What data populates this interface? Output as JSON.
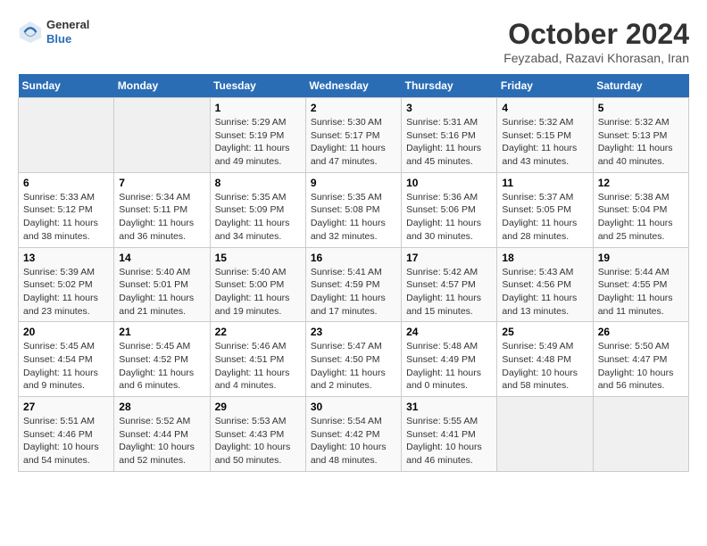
{
  "header": {
    "logo_general": "General",
    "logo_blue": "Blue",
    "month": "October 2024",
    "location": "Feyzabad, Razavi Khorasan, Iran"
  },
  "weekdays": [
    "Sunday",
    "Monday",
    "Tuesday",
    "Wednesday",
    "Thursday",
    "Friday",
    "Saturday"
  ],
  "weeks": [
    [
      {
        "day": "",
        "sunrise": "",
        "sunset": "",
        "daylight": ""
      },
      {
        "day": "",
        "sunrise": "",
        "sunset": "",
        "daylight": ""
      },
      {
        "day": "1",
        "sunrise": "Sunrise: 5:29 AM",
        "sunset": "Sunset: 5:19 PM",
        "daylight": "Daylight: 11 hours and 49 minutes."
      },
      {
        "day": "2",
        "sunrise": "Sunrise: 5:30 AM",
        "sunset": "Sunset: 5:17 PM",
        "daylight": "Daylight: 11 hours and 47 minutes."
      },
      {
        "day": "3",
        "sunrise": "Sunrise: 5:31 AM",
        "sunset": "Sunset: 5:16 PM",
        "daylight": "Daylight: 11 hours and 45 minutes."
      },
      {
        "day": "4",
        "sunrise": "Sunrise: 5:32 AM",
        "sunset": "Sunset: 5:15 PM",
        "daylight": "Daylight: 11 hours and 43 minutes."
      },
      {
        "day": "5",
        "sunrise": "Sunrise: 5:32 AM",
        "sunset": "Sunset: 5:13 PM",
        "daylight": "Daylight: 11 hours and 40 minutes."
      }
    ],
    [
      {
        "day": "6",
        "sunrise": "Sunrise: 5:33 AM",
        "sunset": "Sunset: 5:12 PM",
        "daylight": "Daylight: 11 hours and 38 minutes."
      },
      {
        "day": "7",
        "sunrise": "Sunrise: 5:34 AM",
        "sunset": "Sunset: 5:11 PM",
        "daylight": "Daylight: 11 hours and 36 minutes."
      },
      {
        "day": "8",
        "sunrise": "Sunrise: 5:35 AM",
        "sunset": "Sunset: 5:09 PM",
        "daylight": "Daylight: 11 hours and 34 minutes."
      },
      {
        "day": "9",
        "sunrise": "Sunrise: 5:35 AM",
        "sunset": "Sunset: 5:08 PM",
        "daylight": "Daylight: 11 hours and 32 minutes."
      },
      {
        "day": "10",
        "sunrise": "Sunrise: 5:36 AM",
        "sunset": "Sunset: 5:06 PM",
        "daylight": "Daylight: 11 hours and 30 minutes."
      },
      {
        "day": "11",
        "sunrise": "Sunrise: 5:37 AM",
        "sunset": "Sunset: 5:05 PM",
        "daylight": "Daylight: 11 hours and 28 minutes."
      },
      {
        "day": "12",
        "sunrise": "Sunrise: 5:38 AM",
        "sunset": "Sunset: 5:04 PM",
        "daylight": "Daylight: 11 hours and 25 minutes."
      }
    ],
    [
      {
        "day": "13",
        "sunrise": "Sunrise: 5:39 AM",
        "sunset": "Sunset: 5:02 PM",
        "daylight": "Daylight: 11 hours and 23 minutes."
      },
      {
        "day": "14",
        "sunrise": "Sunrise: 5:40 AM",
        "sunset": "Sunset: 5:01 PM",
        "daylight": "Daylight: 11 hours and 21 minutes."
      },
      {
        "day": "15",
        "sunrise": "Sunrise: 5:40 AM",
        "sunset": "Sunset: 5:00 PM",
        "daylight": "Daylight: 11 hours and 19 minutes."
      },
      {
        "day": "16",
        "sunrise": "Sunrise: 5:41 AM",
        "sunset": "Sunset: 4:59 PM",
        "daylight": "Daylight: 11 hours and 17 minutes."
      },
      {
        "day": "17",
        "sunrise": "Sunrise: 5:42 AM",
        "sunset": "Sunset: 4:57 PM",
        "daylight": "Daylight: 11 hours and 15 minutes."
      },
      {
        "day": "18",
        "sunrise": "Sunrise: 5:43 AM",
        "sunset": "Sunset: 4:56 PM",
        "daylight": "Daylight: 11 hours and 13 minutes."
      },
      {
        "day": "19",
        "sunrise": "Sunrise: 5:44 AM",
        "sunset": "Sunset: 4:55 PM",
        "daylight": "Daylight: 11 hours and 11 minutes."
      }
    ],
    [
      {
        "day": "20",
        "sunrise": "Sunrise: 5:45 AM",
        "sunset": "Sunset: 4:54 PM",
        "daylight": "Daylight: 11 hours and 9 minutes."
      },
      {
        "day": "21",
        "sunrise": "Sunrise: 5:45 AM",
        "sunset": "Sunset: 4:52 PM",
        "daylight": "Daylight: 11 hours and 6 minutes."
      },
      {
        "day": "22",
        "sunrise": "Sunrise: 5:46 AM",
        "sunset": "Sunset: 4:51 PM",
        "daylight": "Daylight: 11 hours and 4 minutes."
      },
      {
        "day": "23",
        "sunrise": "Sunrise: 5:47 AM",
        "sunset": "Sunset: 4:50 PM",
        "daylight": "Daylight: 11 hours and 2 minutes."
      },
      {
        "day": "24",
        "sunrise": "Sunrise: 5:48 AM",
        "sunset": "Sunset: 4:49 PM",
        "daylight": "Daylight: 11 hours and 0 minutes."
      },
      {
        "day": "25",
        "sunrise": "Sunrise: 5:49 AM",
        "sunset": "Sunset: 4:48 PM",
        "daylight": "Daylight: 10 hours and 58 minutes."
      },
      {
        "day": "26",
        "sunrise": "Sunrise: 5:50 AM",
        "sunset": "Sunset: 4:47 PM",
        "daylight": "Daylight: 10 hours and 56 minutes."
      }
    ],
    [
      {
        "day": "27",
        "sunrise": "Sunrise: 5:51 AM",
        "sunset": "Sunset: 4:46 PM",
        "daylight": "Daylight: 10 hours and 54 minutes."
      },
      {
        "day": "28",
        "sunrise": "Sunrise: 5:52 AM",
        "sunset": "Sunset: 4:44 PM",
        "daylight": "Daylight: 10 hours and 52 minutes."
      },
      {
        "day": "29",
        "sunrise": "Sunrise: 5:53 AM",
        "sunset": "Sunset: 4:43 PM",
        "daylight": "Daylight: 10 hours and 50 minutes."
      },
      {
        "day": "30",
        "sunrise": "Sunrise: 5:54 AM",
        "sunset": "Sunset: 4:42 PM",
        "daylight": "Daylight: 10 hours and 48 minutes."
      },
      {
        "day": "31",
        "sunrise": "Sunrise: 5:55 AM",
        "sunset": "Sunset: 4:41 PM",
        "daylight": "Daylight: 10 hours and 46 minutes."
      },
      {
        "day": "",
        "sunrise": "",
        "sunset": "",
        "daylight": ""
      },
      {
        "day": "",
        "sunrise": "",
        "sunset": "",
        "daylight": ""
      }
    ]
  ]
}
